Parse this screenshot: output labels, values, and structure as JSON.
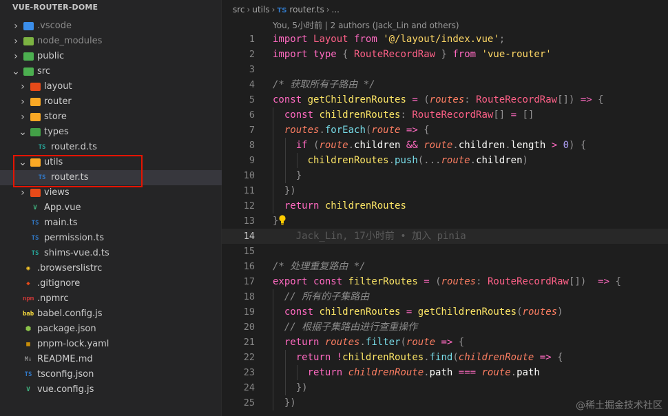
{
  "explorer": {
    "title": "VUE-ROUTER-DOME",
    "items": [
      {
        "label": ".vscode",
        "depth": 0,
        "kind": "folder",
        "twistie": "›",
        "icon": "vscode-folder-icon",
        "icon_color": "#3b8eea",
        "dim": true
      },
      {
        "label": "node_modules",
        "depth": 0,
        "kind": "folder",
        "twistie": "›",
        "icon": "node-folder-icon",
        "icon_color": "#7cb342",
        "dim": true
      },
      {
        "label": "public",
        "depth": 0,
        "kind": "folder",
        "twistie": "›",
        "icon": "public-folder-icon",
        "icon_color": "#4caf50"
      },
      {
        "label": "src",
        "depth": 0,
        "kind": "folder",
        "twistie": "⌄",
        "icon": "src-folder-icon",
        "icon_color": "#4caf50"
      },
      {
        "label": "layout",
        "depth": 1,
        "kind": "folder",
        "twistie": "›",
        "icon": "layout-folder-icon",
        "icon_color": "#e64a19"
      },
      {
        "label": "router",
        "depth": 1,
        "kind": "folder",
        "twistie": "›",
        "icon": "router-folder-icon",
        "icon_color": "#f9a825"
      },
      {
        "label": "store",
        "depth": 1,
        "kind": "folder",
        "twistie": "›",
        "icon": "store-folder-icon",
        "icon_color": "#f9a825"
      },
      {
        "label": "types",
        "depth": 1,
        "kind": "folder",
        "twistie": "⌄",
        "icon": "types-folder-icon",
        "icon_color": "#43a047"
      },
      {
        "label": "router.d.ts",
        "depth": 2,
        "kind": "file",
        "icon": "typescript-def-icon",
        "icon_text": "TS",
        "icon_color": "#26a69a"
      },
      {
        "label": "utils",
        "depth": 1,
        "kind": "folder",
        "twistie": "⌄",
        "icon": "utils-folder-icon",
        "icon_color": "#f9a825"
      },
      {
        "label": "router.ts",
        "depth": 2,
        "kind": "file",
        "icon": "typescript-icon",
        "icon_text": "TS",
        "icon_color": "#3178c6",
        "selected": true
      },
      {
        "label": "views",
        "depth": 1,
        "kind": "folder",
        "twistie": "›",
        "icon": "views-folder-icon",
        "icon_color": "#e64a19"
      },
      {
        "label": "App.vue",
        "depth": 1,
        "kind": "file",
        "icon": "vue-icon",
        "icon_text": "V",
        "icon_color": "#41b883"
      },
      {
        "label": "main.ts",
        "depth": 1,
        "kind": "file",
        "icon": "typescript-icon",
        "icon_text": "TS",
        "icon_color": "#3178c6"
      },
      {
        "label": "permission.ts",
        "depth": 1,
        "kind": "file",
        "icon": "typescript-icon",
        "icon_text": "TS",
        "icon_color": "#3178c6"
      },
      {
        "label": "shims-vue.d.ts",
        "depth": 1,
        "kind": "file",
        "icon": "typescript-def-icon",
        "icon_text": "TS",
        "icon_color": "#26a69a"
      },
      {
        "label": ".browserslistrc",
        "depth": 0,
        "kind": "file",
        "icon": "browserslist-icon",
        "icon_text": "◉",
        "icon_color": "#ffca28"
      },
      {
        "label": ".gitignore",
        "depth": 0,
        "kind": "file",
        "icon": "git-icon",
        "icon_text": "◆",
        "icon_color": "#e64a19"
      },
      {
        "label": ".npmrc",
        "depth": 0,
        "kind": "file",
        "icon": "npm-icon",
        "icon_text": "npm",
        "icon_color": "#cb3837"
      },
      {
        "label": "babel.config.js",
        "depth": 0,
        "kind": "file",
        "icon": "babel-icon",
        "icon_text": "bab",
        "icon_color": "#f9dc3e"
      },
      {
        "label": "package.json",
        "depth": 0,
        "kind": "file",
        "icon": "nodejs-icon",
        "icon_text": "⬢",
        "icon_color": "#8bc34a"
      },
      {
        "label": "pnpm-lock.yaml",
        "depth": 0,
        "kind": "file",
        "icon": "pnpm-icon",
        "icon_text": "▦",
        "icon_color": "#f9ad00"
      },
      {
        "label": "README.md",
        "depth": 0,
        "kind": "file",
        "icon": "markdown-icon",
        "icon_text": "M↓",
        "icon_color": "#8a8a8a"
      },
      {
        "label": "tsconfig.json",
        "depth": 0,
        "kind": "file",
        "icon": "tsconfig-icon",
        "icon_text": "TS",
        "icon_color": "#3178c6"
      },
      {
        "label": "vue.config.js",
        "depth": 0,
        "kind": "file",
        "icon": "vue-config-icon",
        "icon_text": "V",
        "icon_color": "#41b883"
      }
    ]
  },
  "breadcrumb": {
    "parts": [
      "src",
      "utils"
    ],
    "file_badge": "TS",
    "file": "router.ts",
    "tail": "..."
  },
  "blame_header": "You, 5小时前 | 2 authors (Jack_Lin and others)",
  "editor": {
    "current_line": 14,
    "lines": [
      {
        "n": "1",
        "tokens": [
          [
            "kw",
            "import"
          ],
          [
            "plain",
            " "
          ],
          [
            "ty",
            "Layout"
          ],
          [
            "plain",
            " "
          ],
          [
            "kw",
            "from"
          ],
          [
            "plain",
            " "
          ],
          [
            "str",
            "'@/layout/index.vue'"
          ],
          [
            "punc",
            ";"
          ]
        ]
      },
      {
        "n": "2",
        "tokens": [
          [
            "kw",
            "import"
          ],
          [
            "plain",
            " "
          ],
          [
            "kw",
            "type"
          ],
          [
            "plain",
            " "
          ],
          [
            "punc",
            "{"
          ],
          [
            "plain",
            " "
          ],
          [
            "ty",
            "RouteRecordRaw"
          ],
          [
            "plain",
            " "
          ],
          [
            "punc",
            "}"
          ],
          [
            "plain",
            " "
          ],
          [
            "kw",
            "from"
          ],
          [
            "plain",
            " "
          ],
          [
            "str",
            "'vue-router'"
          ]
        ]
      },
      {
        "n": "3",
        "tokens": []
      },
      {
        "n": "4",
        "tokens": [
          [
            "cmt",
            "/* 获取所有子路由 */"
          ]
        ]
      },
      {
        "n": "5",
        "tokens": [
          [
            "kw",
            "const"
          ],
          [
            "plain",
            " "
          ],
          [
            "fn",
            "getChildrenRoutes"
          ],
          [
            "plain",
            " "
          ],
          [
            "kw",
            "="
          ],
          [
            "plain",
            " "
          ],
          [
            "punc",
            "("
          ],
          [
            "param",
            "routes"
          ],
          [
            "punc",
            ":"
          ],
          [
            "plain",
            " "
          ],
          [
            "ty",
            "RouteRecordRaw"
          ],
          [
            "punc",
            "[])"
          ],
          [
            "plain",
            " "
          ],
          [
            "kw",
            "=>"
          ],
          [
            "plain",
            " "
          ],
          [
            "punc",
            "{"
          ]
        ]
      },
      {
        "n": "6",
        "tokens": [
          [
            "plain",
            "  "
          ],
          [
            "kw",
            "const"
          ],
          [
            "plain",
            " "
          ],
          [
            "fn",
            "childrenRoutes"
          ],
          [
            "punc",
            ":"
          ],
          [
            "plain",
            " "
          ],
          [
            "ty",
            "RouteRecordRaw"
          ],
          [
            "punc",
            "[]"
          ],
          [
            "plain",
            " "
          ],
          [
            "kw",
            "="
          ],
          [
            "plain",
            " "
          ],
          [
            "punc",
            "[]"
          ]
        ]
      },
      {
        "n": "7",
        "tokens": [
          [
            "plain",
            "  "
          ],
          [
            "param",
            "routes"
          ],
          [
            "punc",
            "."
          ],
          [
            "prop",
            "forEach"
          ],
          [
            "punc",
            "("
          ],
          [
            "param",
            "route"
          ],
          [
            "plain",
            " "
          ],
          [
            "kw",
            "=>"
          ],
          [
            "plain",
            " "
          ],
          [
            "punc",
            "{"
          ]
        ]
      },
      {
        "n": "8",
        "tokens": [
          [
            "plain",
            "    "
          ],
          [
            "kw",
            "if"
          ],
          [
            "plain",
            " "
          ],
          [
            "punc",
            "("
          ],
          [
            "param",
            "route"
          ],
          [
            "punc",
            "."
          ],
          [
            "plain",
            "children"
          ],
          [
            "plain",
            " "
          ],
          [
            "kw",
            "&&"
          ],
          [
            "plain",
            " "
          ],
          [
            "param",
            "route"
          ],
          [
            "punc",
            "."
          ],
          [
            "plain",
            "children"
          ],
          [
            "punc",
            "."
          ],
          [
            "plain",
            "length"
          ],
          [
            "plain",
            " "
          ],
          [
            "kw",
            ">"
          ],
          [
            "plain",
            " "
          ],
          [
            "num",
            "0"
          ],
          [
            "punc",
            ")"
          ],
          [
            "plain",
            " "
          ],
          [
            "punc",
            "{"
          ]
        ]
      },
      {
        "n": "9",
        "tokens": [
          [
            "plain",
            "      "
          ],
          [
            "fn",
            "childrenRoutes"
          ],
          [
            "punc",
            "."
          ],
          [
            "prop",
            "push"
          ],
          [
            "punc",
            "(..."
          ],
          [
            "param",
            "route"
          ],
          [
            "punc",
            "."
          ],
          [
            "plain",
            "children"
          ],
          [
            "punc",
            ")"
          ]
        ]
      },
      {
        "n": "10",
        "tokens": [
          [
            "plain",
            "    "
          ],
          [
            "punc",
            "}"
          ]
        ]
      },
      {
        "n": "11",
        "tokens": [
          [
            "plain",
            "  "
          ],
          [
            "punc",
            "})"
          ]
        ]
      },
      {
        "n": "12",
        "tokens": [
          [
            "plain",
            "  "
          ],
          [
            "kw",
            "return"
          ],
          [
            "plain",
            " "
          ],
          [
            "fn",
            "childrenRoutes"
          ]
        ]
      },
      {
        "n": "13",
        "tokens": [
          [
            "punc",
            "}"
          ],
          [
            "bulb",
            "lightbulb-icon"
          ]
        ]
      },
      {
        "n": "14",
        "tokens": [
          [
            "plain",
            "    "
          ],
          [
            "blame",
            "Jack_Lin, 17小时前 • 加入 pinia"
          ]
        ]
      },
      {
        "n": "15",
        "tokens": []
      },
      {
        "n": "16",
        "tokens": [
          [
            "cmt",
            "/* 处理重复路由 */"
          ]
        ]
      },
      {
        "n": "17",
        "tokens": [
          [
            "kw",
            "export"
          ],
          [
            "plain",
            " "
          ],
          [
            "kw",
            "const"
          ],
          [
            "plain",
            " "
          ],
          [
            "fn",
            "filterRoutes"
          ],
          [
            "plain",
            " "
          ],
          [
            "kw",
            "="
          ],
          [
            "plain",
            " "
          ],
          [
            "punc",
            "("
          ],
          [
            "param",
            "routes"
          ],
          [
            "punc",
            ":"
          ],
          [
            "plain",
            " "
          ],
          [
            "ty",
            "RouteRecordRaw"
          ],
          [
            "punc",
            "[])"
          ],
          [
            "plain",
            "  "
          ],
          [
            "kw",
            "=>"
          ],
          [
            "plain",
            " "
          ],
          [
            "punc",
            "{"
          ]
        ]
      },
      {
        "n": "18",
        "tokens": [
          [
            "plain",
            "  "
          ],
          [
            "cmt",
            "// 所有的子集路由"
          ]
        ]
      },
      {
        "n": "19",
        "tokens": [
          [
            "plain",
            "  "
          ],
          [
            "kw",
            "const"
          ],
          [
            "plain",
            " "
          ],
          [
            "fn",
            "childrenRoutes"
          ],
          [
            "plain",
            " "
          ],
          [
            "kw",
            "="
          ],
          [
            "plain",
            " "
          ],
          [
            "fn",
            "getChildrenRoutes"
          ],
          [
            "punc",
            "("
          ],
          [
            "param",
            "routes"
          ],
          [
            "punc",
            ")"
          ]
        ]
      },
      {
        "n": "20",
        "tokens": [
          [
            "plain",
            "  "
          ],
          [
            "cmt",
            "// 根据子集路由进行查重操作"
          ]
        ]
      },
      {
        "n": "21",
        "tokens": [
          [
            "plain",
            "  "
          ],
          [
            "kw",
            "return"
          ],
          [
            "plain",
            " "
          ],
          [
            "param",
            "routes"
          ],
          [
            "punc",
            "."
          ],
          [
            "prop",
            "filter"
          ],
          [
            "punc",
            "("
          ],
          [
            "param",
            "route"
          ],
          [
            "plain",
            " "
          ],
          [
            "kw",
            "=>"
          ],
          [
            "plain",
            " "
          ],
          [
            "punc",
            "{"
          ]
        ]
      },
      {
        "n": "22",
        "tokens": [
          [
            "plain",
            "    "
          ],
          [
            "kw",
            "return"
          ],
          [
            "plain",
            " "
          ],
          [
            "kw",
            "!"
          ],
          [
            "fn",
            "childrenRoutes"
          ],
          [
            "punc",
            "."
          ],
          [
            "prop",
            "find"
          ],
          [
            "punc",
            "("
          ],
          [
            "param",
            "childrenRoute"
          ],
          [
            "plain",
            " "
          ],
          [
            "kw",
            "=>"
          ],
          [
            "plain",
            " "
          ],
          [
            "punc",
            "{"
          ]
        ]
      },
      {
        "n": "23",
        "tokens": [
          [
            "plain",
            "      "
          ],
          [
            "kw",
            "return"
          ],
          [
            "plain",
            " "
          ],
          [
            "param",
            "childrenRoute"
          ],
          [
            "punc",
            "."
          ],
          [
            "plain",
            "path"
          ],
          [
            "plain",
            " "
          ],
          [
            "kw",
            "==="
          ],
          [
            "plain",
            " "
          ],
          [
            "param",
            "route"
          ],
          [
            "punc",
            "."
          ],
          [
            "plain",
            "path"
          ]
        ]
      },
      {
        "n": "24",
        "tokens": [
          [
            "plain",
            "    "
          ],
          [
            "punc",
            "})"
          ]
        ]
      },
      {
        "n": "25",
        "tokens": [
          [
            "plain",
            "  "
          ],
          [
            "punc",
            "})"
          ]
        ]
      }
    ]
  },
  "watermark": "@稀土掘金技术社区"
}
